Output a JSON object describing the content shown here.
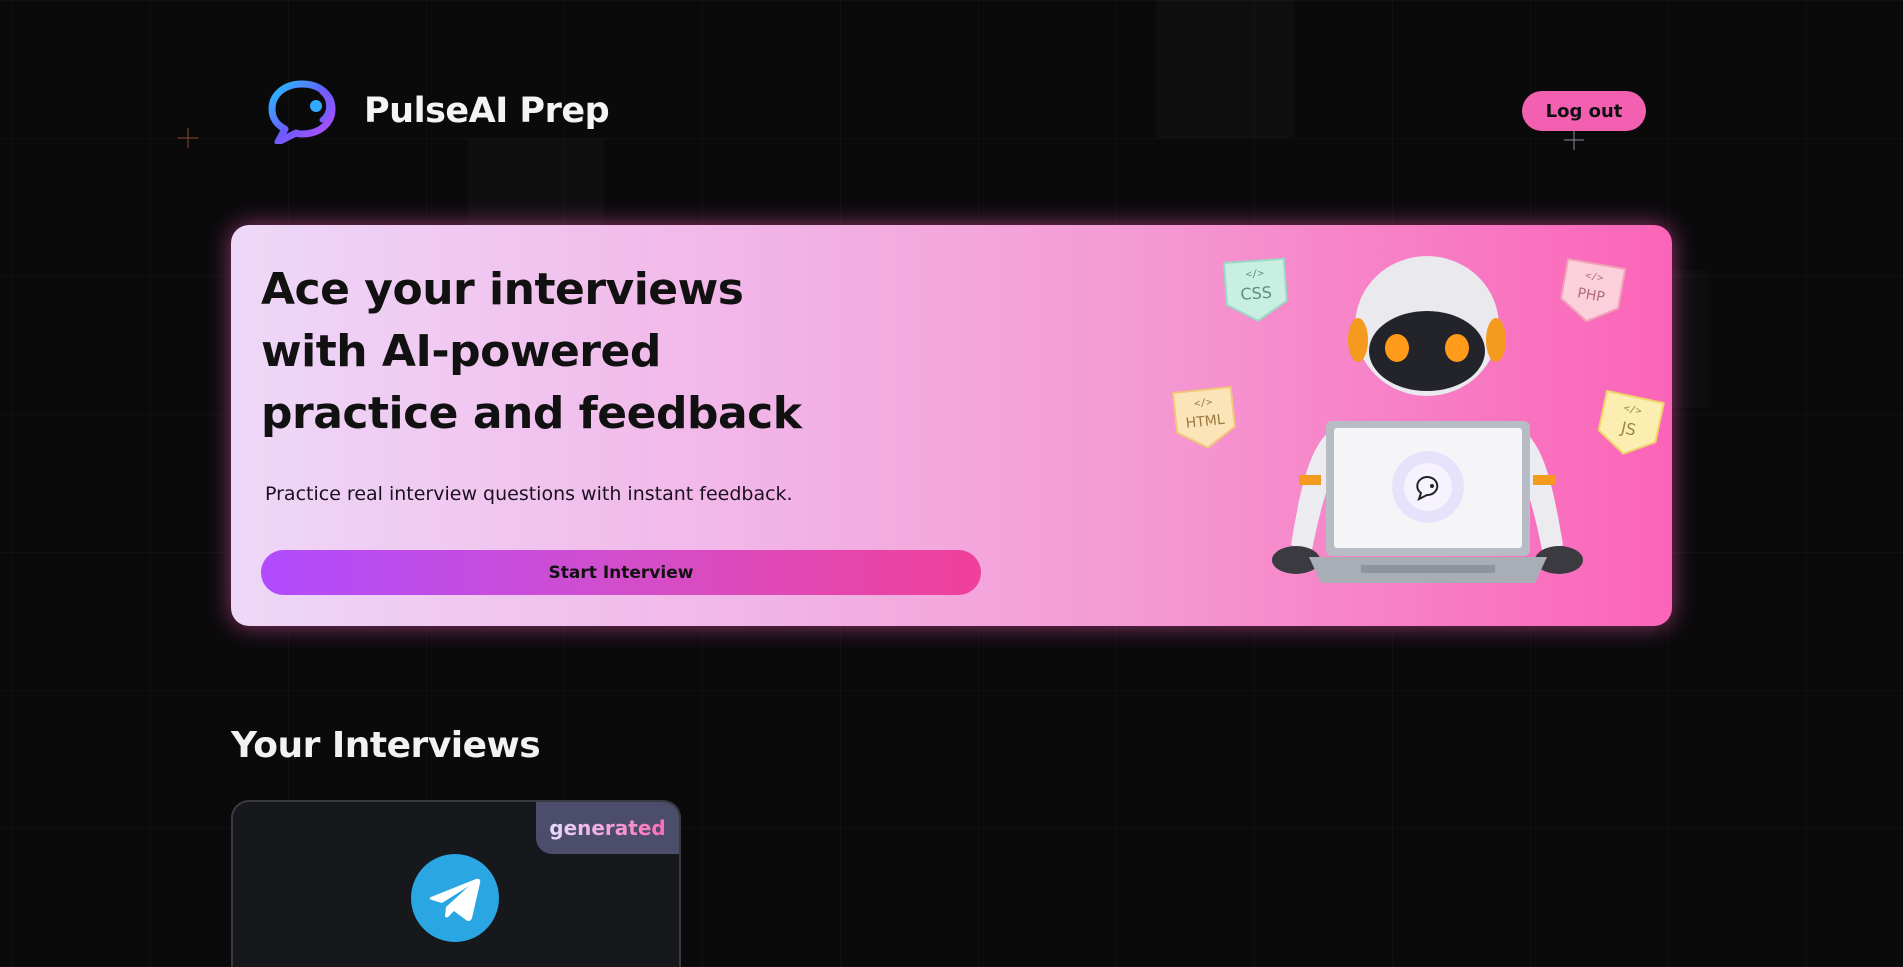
{
  "app": {
    "brand_name": "PulseAI Prep",
    "logout_label": "Log out"
  },
  "hero": {
    "title": "Ace your interviews with AI-powered practice and feedback",
    "subtitle": "Practice real interview questions with instant feedback.",
    "cta_label": "Start Interview",
    "badges": [
      "CSS",
      "PHP",
      "HTML",
      "JS"
    ]
  },
  "interviews": {
    "section_title": "Your Interviews",
    "cards": [
      {
        "badge": "generated",
        "icon": "telegram-icon"
      }
    ]
  },
  "colors": {
    "background": "#0a0a0b",
    "accent_pink": "#f35fb1",
    "accent_purple": "#b04cff",
    "badge_bg": "#4b4d6a"
  }
}
